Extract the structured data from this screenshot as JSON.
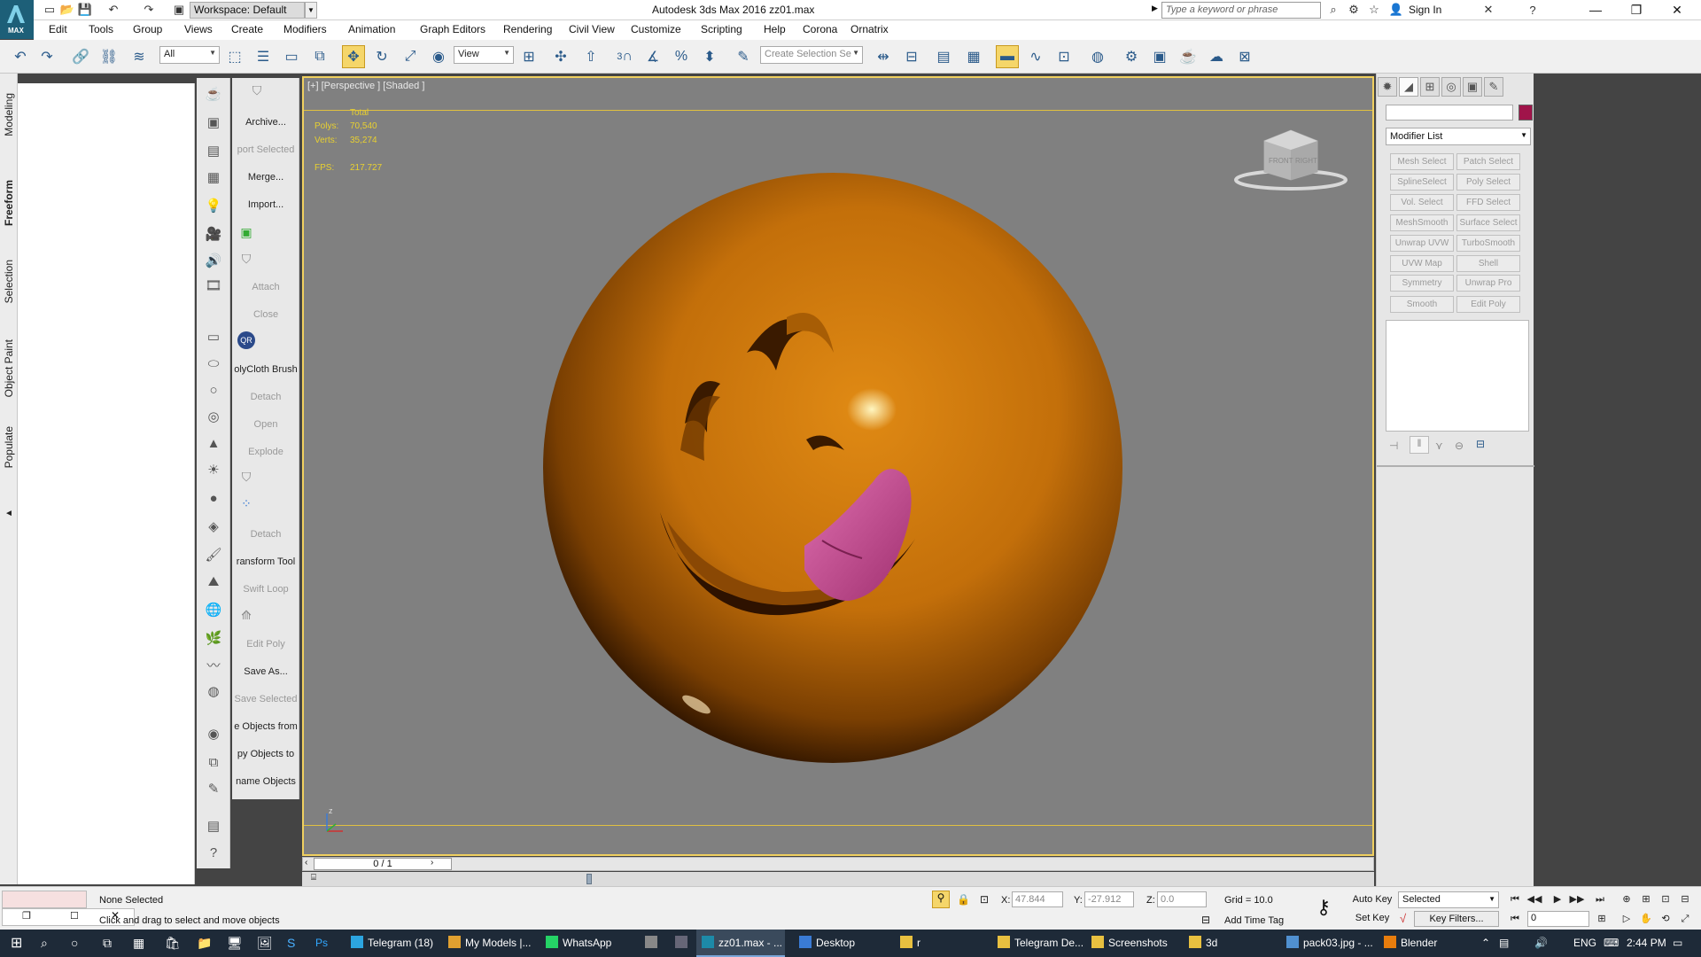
{
  "titlebar": {
    "workspace": "Workspace: Default",
    "window_title": "Autodesk 3ds Max 2016      zz01.max",
    "search_placeholder": "Type a keyword or phrase",
    "sign_in": "Sign In",
    "app_logo_caption": "MAX"
  },
  "menu": [
    "Edit",
    "Tools",
    "Group",
    "Views",
    "Create",
    "Modifiers",
    "Animation",
    "Graph Editors",
    "Rendering",
    "Civil View",
    "Customize",
    "Scripting",
    "Help",
    "Corona",
    "Ornatrix"
  ],
  "toolbar": {
    "selection_filter": "All",
    "ref_coord": "View",
    "selection_set_placeholder": "Create Selection Se",
    "snap_label": "3"
  },
  "ribbon_tabs": [
    "Modeling",
    "Freeform",
    "Selection",
    "Object Paint",
    "Populate"
  ],
  "script_panel": {
    "items": [
      {
        "label": "Archive...",
        "dim": false
      },
      {
        "label": "port Selected",
        "dim": true
      },
      {
        "label": "Merge...",
        "dim": false
      },
      {
        "label": "Import...",
        "dim": false
      },
      {
        "label": "Attach",
        "dim": true
      },
      {
        "label": "Close",
        "dim": true
      },
      {
        "label": "olyCloth Brush",
        "dim": false
      },
      {
        "label": "Detach",
        "dim": true
      },
      {
        "label": "Open",
        "dim": true
      },
      {
        "label": "Explode",
        "dim": true
      },
      {
        "label": "Detach",
        "dim": true
      },
      {
        "label": "ransform Tool",
        "dim": false
      },
      {
        "label": "Swift Loop",
        "dim": true
      },
      {
        "label": "Edit Poly",
        "dim": true
      },
      {
        "label": "Save As...",
        "dim": false
      },
      {
        "label": "Save Selected",
        "dim": true
      },
      {
        "label": "e Objects from",
        "dim": false
      },
      {
        "label": "py Objects to",
        "dim": false
      },
      {
        "label": "name Objects",
        "dim": false
      }
    ],
    "qr_label": "QR"
  },
  "viewport": {
    "label": "[+] [Perspective ] [Shaded ]",
    "stats": {
      "total_label": "Total",
      "polys_label": "Polys:",
      "polys_value": "70,540",
      "verts_label": "Verts:",
      "verts_value": "35,274",
      "fps_label": "FPS:",
      "fps_value": "217.727"
    },
    "viewcube_front": "FRONT",
    "viewcube_right": "RIGHT",
    "axis_z": "z",
    "sphere_color": "#c97810",
    "tongue_color": "#d0559a"
  },
  "timeslider": {
    "frame_display": "0 / 1"
  },
  "command_panel": {
    "modifier_list": "Modifier List",
    "object_color": "#a0144a",
    "modifiers": [
      "Mesh Select",
      "Patch Select",
      "SplineSelect",
      "Poly Select",
      "Vol. Select",
      "FFD Select",
      "MeshSmooth",
      "Surface Select",
      "Unwrap UVW",
      "TurboSmooth",
      "UVW Map",
      "Shell",
      "Symmetry",
      "Unwrap Pro",
      "Smooth",
      "Edit Poly"
    ]
  },
  "status": {
    "selection": "None Selected",
    "prompt": "Click and drag to select and move objects",
    "x_label": "X:",
    "x_value": "47.844",
    "y_label": "Y:",
    "y_value": "-27.912",
    "z_label": "Z:",
    "z_value": "0.0",
    "grid": "Grid = 10.0",
    "add_time_tag": "Add Time Tag",
    "auto_key": "Auto Key",
    "set_key": "Set Key",
    "key_mode": "Selected",
    "key_filters": "Key Filters...",
    "frame": "0"
  },
  "taskbar": {
    "tasks": [
      {
        "label": "Telegram (18)",
        "active": false,
        "color": "#2ca5e0"
      },
      {
        "label": "My Models |...",
        "active": false,
        "color": "#e0a030"
      },
      {
        "label": "WhatsApp",
        "active": false,
        "color": "#25d366"
      },
      {
        "label": "zz01.max - ...",
        "active": true,
        "color": "#1d8aa8"
      },
      {
        "label": "Desktop",
        "active": false,
        "color": "#3a7bd5"
      },
      {
        "label": "r",
        "active": false,
        "color": "#e8c040"
      },
      {
        "label": "Telegram De...",
        "active": false,
        "color": "#e8c040"
      },
      {
        "label": "Screenshots",
        "active": false,
        "color": "#e8c040"
      },
      {
        "label": "3d",
        "active": false,
        "color": "#e8c040"
      },
      {
        "label": "pack03.jpg - ...",
        "active": false,
        "color": "#5090d0"
      },
      {
        "label": "Blender",
        "active": false,
        "color": "#e87d0d"
      }
    ],
    "language": "ENG",
    "clock": "2:44 PM"
  }
}
